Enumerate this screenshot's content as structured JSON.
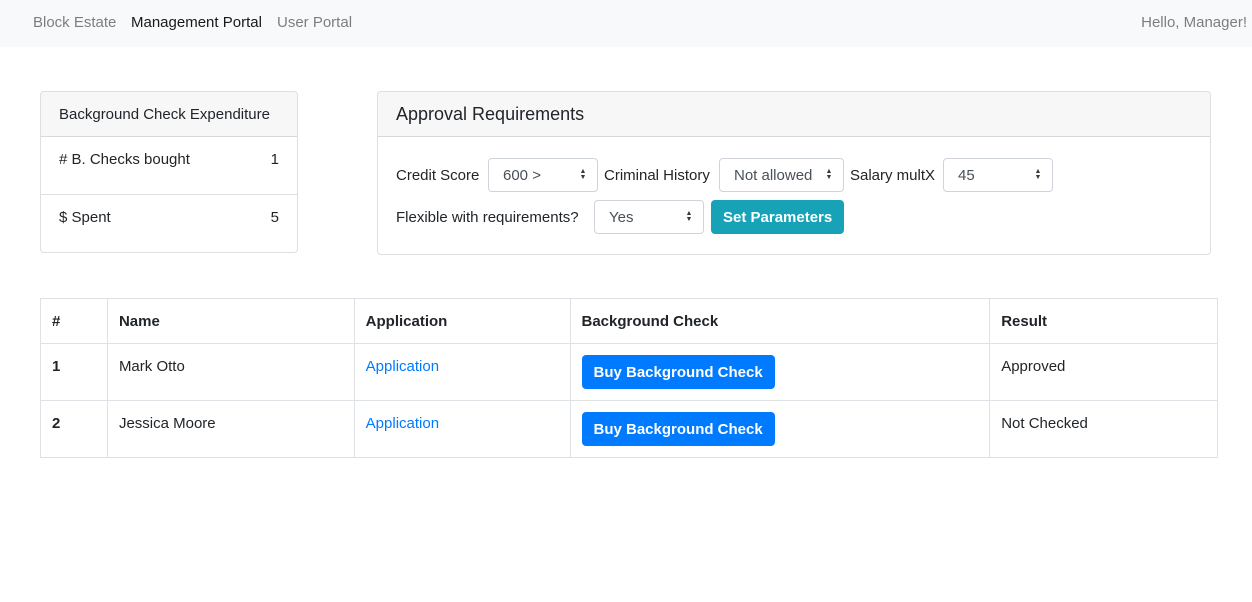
{
  "nav": {
    "brand": "Block Estate",
    "links": [
      "Management Portal",
      "User Portal"
    ],
    "greeting": "Hello, Manager!"
  },
  "expenditure": {
    "title": "Background Check Expenditure",
    "rows": [
      {
        "label": "# B. Checks bought",
        "value": "1"
      },
      {
        "label": "$ Spent",
        "value": "5"
      }
    ]
  },
  "approval": {
    "title": "Approval Requirements",
    "credit_label": "Credit Score",
    "credit_value": "600 >",
    "criminal_label": "Criminal History",
    "criminal_value": "Not allowed",
    "salary_label": "Salary multX",
    "salary_value": "45",
    "flexible_label": "Flexible with requirements?",
    "flexible_value": "Yes",
    "submit_label": "Set Parameters"
  },
  "table": {
    "headers": [
      "#",
      "Name",
      "Application",
      "Background Check",
      "Result"
    ],
    "rows": [
      {
        "num": "1",
        "name": "Mark Otto",
        "application": "Application",
        "action": "Buy Background Check",
        "result": "Approved"
      },
      {
        "num": "2",
        "name": "Jessica Moore",
        "application": "Application",
        "action": "Buy Background Check",
        "result": "Not Checked"
      }
    ]
  },
  "icons": {
    "select_caret": "select-caret-icon"
  },
  "colors": {
    "primary": "#007bff",
    "info": "#17a2b8",
    "navbar_bg": "#f8f9fa"
  }
}
